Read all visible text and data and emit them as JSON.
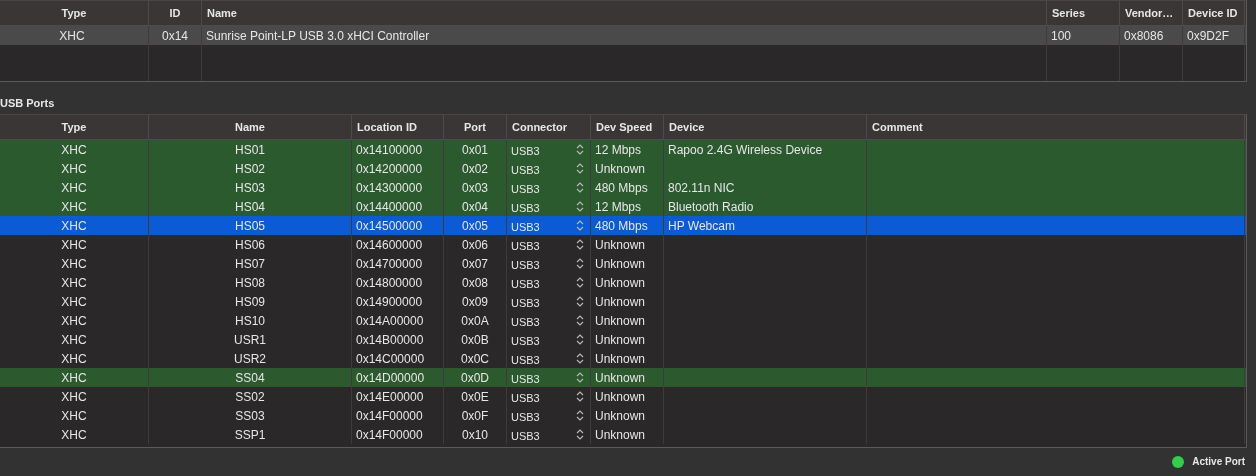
{
  "controllers": {
    "columns": [
      "Type",
      "ID",
      "Name",
      "Series",
      "Vendor…",
      "Device ID"
    ],
    "rows": [
      {
        "cells": [
          "XHC",
          "0x14",
          "Sunrise Point-LP USB 3.0 xHCI Controller",
          "100",
          "0x8086",
          "0x9D2F"
        ],
        "selected": true
      }
    ]
  },
  "ports_title": "USB Ports",
  "ports": {
    "columns": [
      "Type",
      "Name",
      "Location ID",
      "Port",
      "Connector",
      "Dev Speed",
      "Device",
      "Comment"
    ],
    "rows": [
      {
        "type": "XHC",
        "name": "HS01",
        "location": "0x14100000",
        "port": "0x01",
        "connector": "USB3",
        "speed": "12 Mbps",
        "device": "Rapoo 2.4G Wireless Device",
        "active": true,
        "selected": false
      },
      {
        "type": "XHC",
        "name": "HS02",
        "location": "0x14200000",
        "port": "0x02",
        "connector": "USB3",
        "speed": "Unknown",
        "device": "",
        "active": true,
        "selected": false
      },
      {
        "type": "XHC",
        "name": "HS03",
        "location": "0x14300000",
        "port": "0x03",
        "connector": "USB3",
        "speed": "480 Mbps",
        "device": "802.11n NIC",
        "active": true,
        "selected": false
      },
      {
        "type": "XHC",
        "name": "HS04",
        "location": "0x14400000",
        "port": "0x04",
        "connector": "USB3",
        "speed": "12 Mbps",
        "device": "Bluetooth Radio",
        "active": true,
        "selected": false
      },
      {
        "type": "XHC",
        "name": "HS05",
        "location": "0x14500000",
        "port": "0x05",
        "connector": "USB3",
        "speed": "480 Mbps",
        "device": "HP Webcam",
        "selected": true
      },
      {
        "type": "XHC",
        "name": "HS06",
        "location": "0x14600000",
        "port": "0x06",
        "connector": "USB3",
        "speed": "Unknown",
        "device": "",
        "active": false,
        "selected": false
      },
      {
        "type": "XHC",
        "name": "HS07",
        "location": "0x14700000",
        "port": "0x07",
        "connector": "USB3",
        "speed": "Unknown",
        "device": "",
        "active": false,
        "selected": false
      },
      {
        "type": "XHC",
        "name": "HS08",
        "location": "0x14800000",
        "port": "0x08",
        "connector": "USB3",
        "speed": "Unknown",
        "device": "",
        "active": false,
        "selected": false
      },
      {
        "type": "XHC",
        "name": "HS09",
        "location": "0x14900000",
        "port": "0x09",
        "connector": "USB3",
        "speed": "Unknown",
        "device": "",
        "active": false,
        "selected": false
      },
      {
        "type": "XHC",
        "name": "HS10",
        "location": "0x14A00000",
        "port": "0x0A",
        "connector": "USB3",
        "speed": "Unknown",
        "device": "",
        "active": false,
        "selected": false
      },
      {
        "type": "XHC",
        "name": "USR1",
        "location": "0x14B00000",
        "port": "0x0B",
        "connector": "USB3",
        "speed": "Unknown",
        "device": "",
        "active": false,
        "selected": false
      },
      {
        "type": "XHC",
        "name": "USR2",
        "location": "0x14C00000",
        "port": "0x0C",
        "connector": "USB3",
        "speed": "Unknown",
        "device": "",
        "active": false,
        "selected": false
      },
      {
        "type": "XHC",
        "name": "SS04",
        "location": "0x14D00000",
        "port": "0x0D",
        "connector": "USB3",
        "speed": "Unknown",
        "device": "",
        "active": true,
        "selected": false
      },
      {
        "type": "XHC",
        "name": "SS02",
        "location": "0x14E00000",
        "port": "0x0E",
        "connector": "USB3",
        "speed": "Unknown",
        "device": "",
        "active": false,
        "selected": false
      },
      {
        "type": "XHC",
        "name": "SS03",
        "location": "0x14F00000",
        "port": "0x0F",
        "connector": "USB3",
        "speed": "Unknown",
        "device": "",
        "active": false,
        "selected": false
      },
      {
        "type": "XHC",
        "name": "SSP1",
        "location": "0x14F00000",
        "port": "0x10",
        "connector": "USB3",
        "speed": "Unknown",
        "device": "",
        "active": false,
        "selected": false
      }
    ]
  },
  "legend": {
    "label": "Active Port",
    "color": "#2fd04a"
  }
}
